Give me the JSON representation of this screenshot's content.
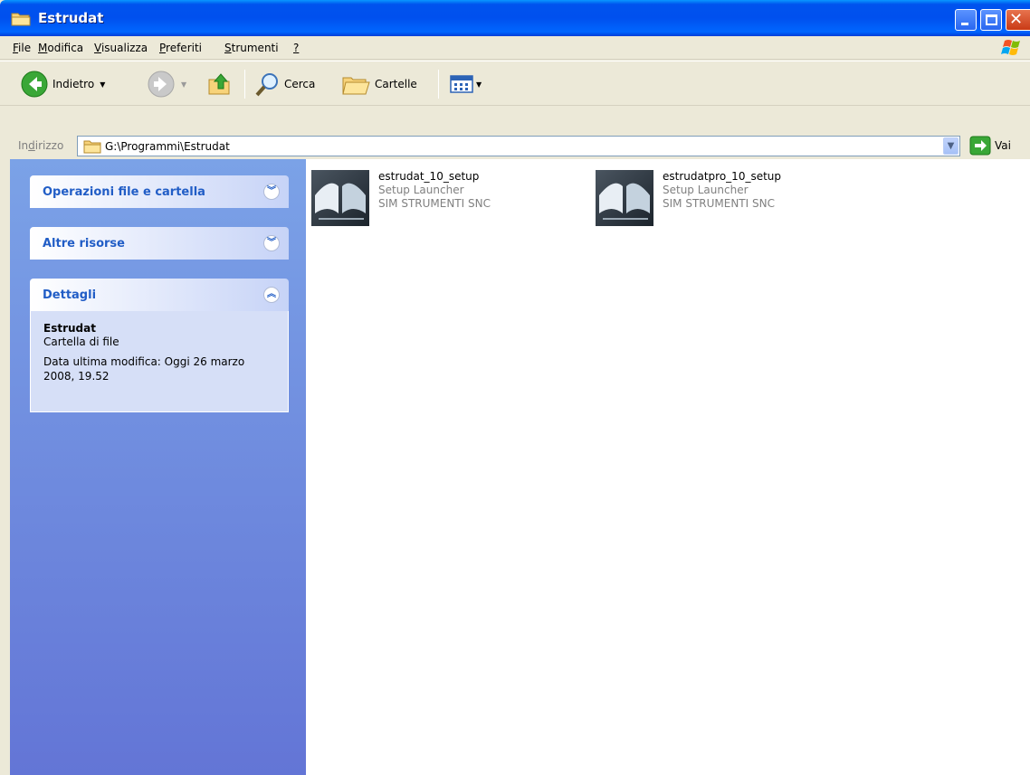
{
  "window": {
    "title": "Estrudat"
  },
  "menu": [
    {
      "label": "File",
      "ul": "F",
      "rest": "ile"
    },
    {
      "label": "Modifica",
      "ul": "M",
      "rest": "odifica"
    },
    {
      "label": "Visualizza",
      "ul": "V",
      "rest": "isualizza"
    },
    {
      "label": "Preferiti",
      "ul": "P",
      "rest": "referiti"
    },
    {
      "label": "Strumenti",
      "ul": "S",
      "rest": "trumenti"
    },
    {
      "label": "?",
      "ul": "?",
      "rest": ""
    }
  ],
  "toolbar": {
    "back_label": "Indietro",
    "search_label": "Cerca",
    "folders_label": "Cartelle"
  },
  "address": {
    "label_pre": "In",
    "label_ul": "d",
    "label_post": "irizzo",
    "path": "G:\\Programmi\\Estrudat",
    "go_label": "Vai"
  },
  "taskpane": {
    "file_ops_title": "Operazioni file e cartella",
    "other_title": "Altre risorse",
    "details_title": "Dettagli",
    "details": {
      "name": "Estrudat",
      "type": "Cartella di file",
      "modified_line1": "Data ultima modifica: Oggi 26 marzo",
      "modified_line2": "2008, 19.52"
    }
  },
  "files": [
    {
      "name": "estrudat_10_setup",
      "desc": "Setup Launcher",
      "company": "SIM STRUMENTI SNC"
    },
    {
      "name": "estrudatpro_10_setup",
      "desc": "Setup Launcher",
      "company": "SIM STRUMENTI SNC"
    }
  ],
  "colors": {
    "titlebar": "#0050ee",
    "taskpane_top": "#7ba2e7",
    "taskpane_bottom": "#6375d6",
    "panel_title": "#215dc6"
  }
}
